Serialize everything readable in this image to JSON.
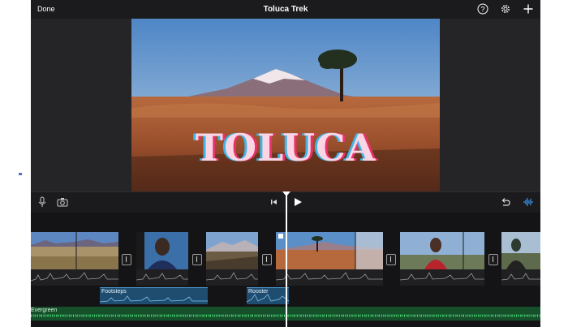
{
  "toolbar": {
    "done_label": "Done",
    "project_title": "Toluca Trek",
    "help_icon": "help-icon",
    "settings_icon": "gear-icon",
    "add_icon": "plus-icon"
  },
  "viewer": {
    "overlay_title": "TOLUCA"
  },
  "controls": {
    "mic_icon": "microphone-icon",
    "camera_icon": "camera-icon",
    "skip_back_icon": "skip-to-start-icon",
    "play_icon": "play-icon",
    "undo_icon": "undo-icon",
    "audio_icon": "audio-waveform-icon"
  },
  "timeline": {
    "audio_clips": [
      {
        "label": "Footsteps"
      },
      {
        "label": "Rooster"
      }
    ],
    "music_track": {
      "label": "Evergreen"
    }
  },
  "colors": {
    "accent": "#3a8ee6",
    "audio_clip": "#1f4d6f",
    "music_track": "#15502b",
    "title_fill": "#fbd5e3"
  }
}
